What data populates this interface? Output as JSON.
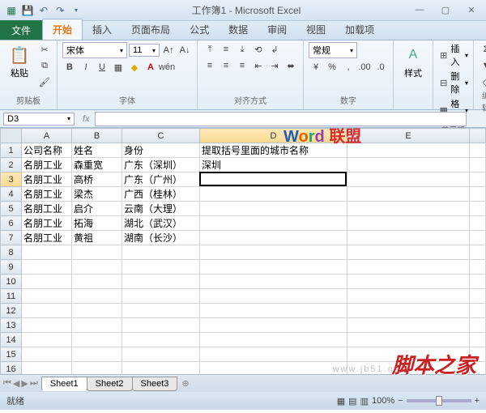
{
  "title": "工作簿1 - Microsoft Excel",
  "ribbon_tabs": {
    "file": "文件",
    "home": "开始",
    "insert": "插入",
    "layout": "页面布局",
    "formulas": "公式",
    "data": "数据",
    "review": "审阅",
    "view": "视图",
    "addins": "加载项"
  },
  "ribbon": {
    "clipboard": {
      "paste": "粘贴",
      "label": "剪贴板"
    },
    "font": {
      "name": "宋体",
      "size": "11",
      "label": "字体"
    },
    "align": {
      "label": "对齐方式",
      "general": "常规"
    },
    "number": {
      "label": "数字"
    },
    "styles": {
      "label": "样式"
    },
    "cells": {
      "insert": "插入",
      "delete": "删除",
      "format": "格式",
      "label": "单元格"
    },
    "editing": {
      "label": "编辑"
    }
  },
  "namebox": "D3",
  "columns": [
    "A",
    "B",
    "C",
    "D",
    "E"
  ],
  "rows_count": 17,
  "active": {
    "row": 3,
    "col": "D"
  },
  "cells": {
    "A1": "公司名称",
    "B1": "姓名",
    "C1": "身份",
    "D1": "提取括号里面的城市名称",
    "A2": "名朋工业",
    "B2": "森重宽",
    "C2": "广东（深圳）",
    "D2": "深圳",
    "A3": "名朋工业",
    "B3": "高桥",
    "C3": "广东（广州）",
    "A4": "名朋工业",
    "B4": "梁杰",
    "C4": "广西（桂林）",
    "A5": "名朋工业",
    "B5": "启介",
    "C5": "云南（大理）",
    "A6": "名朋工业",
    "B6": "拓海",
    "C6": "湖北（武汉）",
    "A7": "名朋工业",
    "B7": "黄祖",
    "C7": "湖南（长沙）"
  },
  "sheets": [
    "Sheet1",
    "Sheet2",
    "Sheet3"
  ],
  "status": {
    "ready": "就绪",
    "zoom": "100%"
  },
  "watermarks": {
    "main": "脚本之家",
    "word": "Word",
    "lianmeng": "联盟",
    "url": "www.jb51.net"
  }
}
